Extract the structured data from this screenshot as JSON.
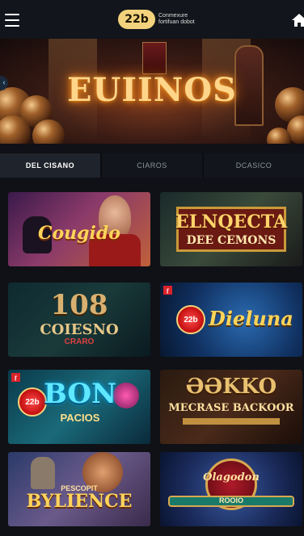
{
  "header": {
    "logo_badge": "22b",
    "logo_text": "Conmexure fortifuan dobot"
  },
  "hero": {
    "title": "EUIINOS"
  },
  "tabs": [
    {
      "label": "DEL CISANO",
      "active": true
    },
    {
      "label": "CIAROS",
      "active": false
    },
    {
      "label": "DCASICO",
      "active": false
    }
  ],
  "games": [
    {
      "title": "Cougido",
      "subtitle": "",
      "badge": ""
    },
    {
      "title": "ELNQECTA",
      "subtitle": "DEE CEMONS",
      "badge": ""
    },
    {
      "title": "108",
      "subtitle": "COIESNO",
      "sub2": "CRARO",
      "badge": ""
    },
    {
      "title": "Dieluna",
      "subtitle": "",
      "badge": "22b"
    },
    {
      "title": "BON",
      "subtitle": "PACIOS",
      "badge": "22b"
    },
    {
      "title": "ƏƏKKO",
      "subtitle": "MECRASE BACKOOR",
      "badge": ""
    },
    {
      "title": "BYLIENCE",
      "subtitle": "PESCOPIT",
      "badge": ""
    },
    {
      "title": "Olagodon",
      "subtitle": "ROOIO",
      "badge": ""
    }
  ],
  "colors": {
    "accent_gold": "#f2d27c",
    "background": "#0f1116",
    "tab_active": "#1f232b"
  }
}
